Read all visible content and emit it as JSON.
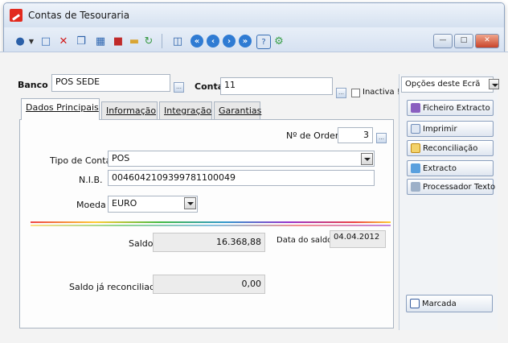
{
  "window": {
    "title": "Contas de Tesouraria"
  },
  "toolbar": {
    "icons": [
      "search-icon",
      "dropdown-arrow-icon",
      "new-document-icon",
      "delete-icon",
      "copy-icon",
      "calculator-icon",
      "users-icon",
      "folder-icon",
      "refresh-icon",
      "preview-icon",
      "first-record-icon",
      "previous-record-icon",
      "next-record-icon",
      "last-record-icon",
      "help-icon",
      "exit-icon"
    ]
  },
  "form": {
    "banco_label": "Banco",
    "banco_value": "POS SEDE",
    "conta_label": "Conta",
    "conta_value": "11",
    "inactiva_label": "Inactiva !",
    "tabs": [
      "Dados Principais",
      "Informação",
      "Integração",
      "Garantias"
    ],
    "active_tab": "Dados Principais",
    "ordem_label": "Nº de Ordem",
    "ordem_value": "3",
    "tipo_label": "Tipo de Conta",
    "tipo_value": "POS",
    "nib_label": "N.I.B.",
    "nib_value": "0046042109399781100049",
    "moeda_label": "Moeda",
    "moeda_value": "EURO",
    "saldo_label": "Saldo",
    "saldo_value": "16.368,88",
    "data_saldo_label": "Data do saldo",
    "data_saldo_value": "04.04.2012",
    "saldo_rec_label": "Saldo já reconciliado",
    "saldo_rec_value": "0,00"
  },
  "sidebar": {
    "options_label": "Opções deste Ecrã",
    "buttons": [
      "Ficheiro Extracto",
      "Imprimir",
      "Reconciliação",
      "Extracto",
      "Processador Texto"
    ],
    "marcada": "Marcada"
  },
  "colors": {
    "accent": "#2f7bd3",
    "title_bg": "#dfe8f4"
  }
}
